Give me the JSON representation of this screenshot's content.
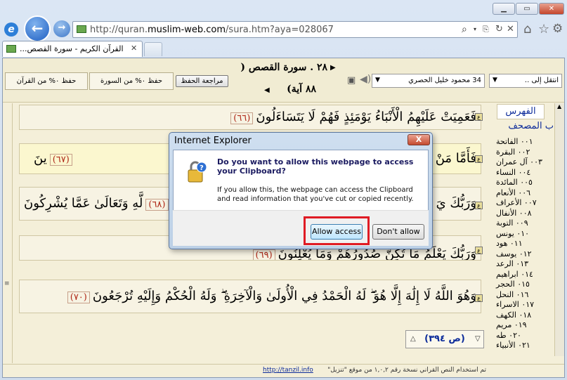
{
  "browser": {
    "url_prefix": "http://quran.",
    "url_domain": "muslim-web.com",
    "url_suffix": "/sura.htm?aya=028067",
    "tab_title": "القرآن الكريم - سورة القصص...",
    "icons": [
      "back-icon",
      "forward-icon",
      "ie-logo-icon",
      "search-icon",
      "refresh-icon",
      "stop-icon",
      "home-icon",
      "favorites-icon",
      "settings-icon"
    ]
  },
  "toolbar": {
    "goto_select": "انتقل إلى ..",
    "reciter_select": "34 محمود خليل الحصري",
    "sura_title": "٢٨ . سورة القصص (",
    "aya_count": "٨٨ آية)",
    "review_btn": "مراجعة الحفظ",
    "memo_sura": "حفظ ٠% من السورة",
    "memo_quran": "حفظ ٠% من القرآن"
  },
  "verses": [
    {
      "text": "فَعَمِيَتْ عَلَيْهِمُ الْأَنْبَاءُ يَوْمَئِذٍ فَهُمْ لَا يَتَسَاءَلُونَ",
      "num": "(٦٦)"
    },
    {
      "text": "فَأَمَّا مَنْ",
      "tail": "ينَ",
      "num": "(٦٧)"
    },
    {
      "text": "وَرَبُّكَ يَ",
      "tail": "لَّهِ وَتَعَالَىٰ عَمَّا يُشْرِكُونَ",
      "num": "(٦٨)"
    },
    {
      "text": "وَرَبُّكَ يَعْلَمُ مَا تُكِنُّ صُدُورُهُمْ وَمَا يُعْلِنُونَ",
      "num": "(٦٩)"
    },
    {
      "text": "وَهُوَ اللَّهُ لَا إِلَٰهَ إِلَّا هُوَ ۖ لَهُ الْحَمْدُ فِي الْأُولَىٰ وَالْآخِرَةِ ۖ وَلَهُ الْحُكْمُ وَإِلَيْهِ تُرْجَعُونَ",
      "num": "(٧٠)"
    }
  ],
  "page_box": "(ص ٣٩٤)",
  "index": {
    "header": "الفهرس",
    "subheader": "ب المصحف",
    "items": [
      "٠٠١ الفاتحة",
      "٠٠٢ البقرة",
      "٠٠٣ آل عمران",
      "٠٠٤ النساء",
      "٠٠٥ المائدة",
      "٠٠٦ الأنعام",
      "٠٠٧ الأعراف",
      "٠٠٨ الأنفال",
      "٠٠٩ التوبة",
      "٠١٠ يونس",
      "٠١١ هود",
      "٠١٢ يوسف",
      "٠١٣ الرعد",
      "٠١٤ ابراهيم",
      "٠١٥ الحجر",
      "٠١٦ النحل",
      "٠١٧ الاسراء",
      "٠١٨ الكهف",
      "٠١٩ مريم",
      "٠٢٠ طه",
      "٠٢١ الأنبياء"
    ]
  },
  "footer": {
    "link": "http://tanzil.info",
    "text": "تم استخدام النص القرآني نسخة رقم ١,٠,٢ من موقع \"تنزيل\""
  },
  "dialog": {
    "title": "Internet Explorer",
    "close": "X",
    "question": "Do you want to allow this webpage to access your Clipboard?",
    "info": "If you allow this, the webpage can access the Clipboard and read information that you've cut or copied recently.",
    "allow": "Allow access",
    "deny": "Don't allow"
  },
  "colors": {
    "highlight": "#e01b24",
    "verse_num": "#b02a1a",
    "link": "#0b2a9a"
  }
}
